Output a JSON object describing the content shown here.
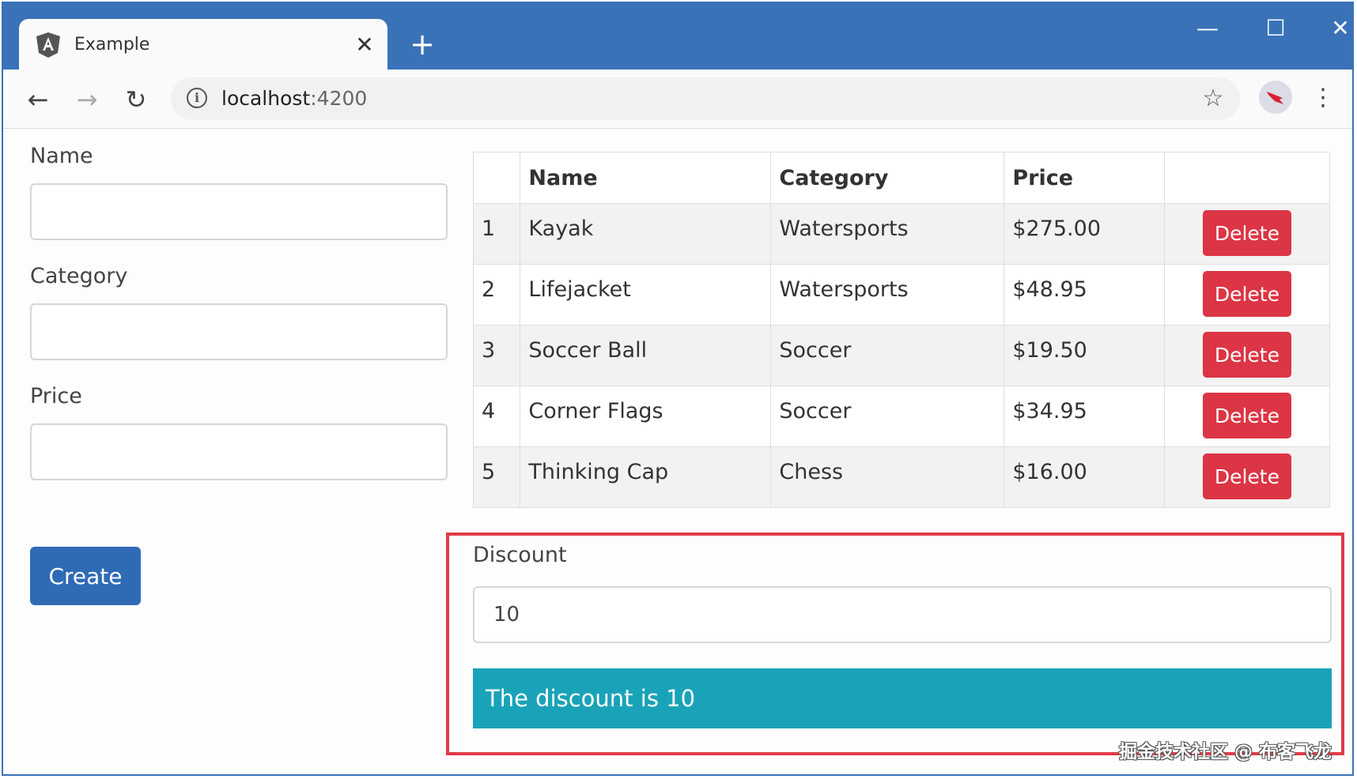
{
  "browser": {
    "tab_title": "Example",
    "tab_close": "✕",
    "new_tab": "+",
    "minimize": "—",
    "maximize": "☐",
    "close": "✕",
    "back": "←",
    "forward": "→",
    "reload": "↻",
    "url_host": "localhost",
    "url_port": ":4200",
    "star": "☆",
    "menu": "⋮",
    "info": "i"
  },
  "form": {
    "name_label": "Name",
    "name_value": "",
    "category_label": "Category",
    "category_value": "",
    "price_label": "Price",
    "price_value": "",
    "create_label": "Create"
  },
  "table": {
    "headers": [
      "",
      "Name",
      "Category",
      "Price",
      ""
    ],
    "delete_label": "Delete",
    "rows": [
      {
        "id": "1",
        "name": "Kayak",
        "category": "Watersports",
        "price": "$275.00"
      },
      {
        "id": "2",
        "name": "Lifejacket",
        "category": "Watersports",
        "price": "$48.95"
      },
      {
        "id": "3",
        "name": "Soccer Ball",
        "category": "Soccer",
        "price": "$19.50"
      },
      {
        "id": "4",
        "name": "Corner Flags",
        "category": "Soccer",
        "price": "$34.95"
      },
      {
        "id": "5",
        "name": "Thinking Cap",
        "category": "Chess",
        "price": "$16.00"
      }
    ]
  },
  "discount": {
    "label": "Discount",
    "value": "10",
    "display": "The discount is 10"
  },
  "watermark": "掘金技术社区 @ 布客飞龙",
  "colors": {
    "titlebar": "#3a72b8",
    "create_button": "#2f6bb5",
    "delete_button": "#dc3545",
    "discount_display": "#1aa3b8",
    "highlight_border": "#e03b47"
  }
}
